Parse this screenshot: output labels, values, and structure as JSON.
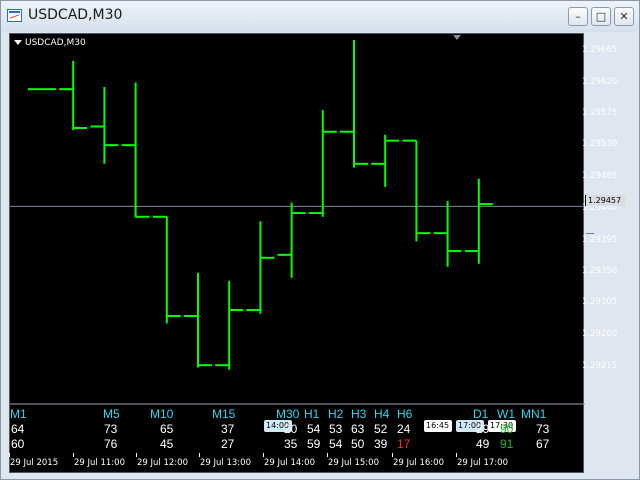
{
  "window": {
    "title": "USDCAD,M30",
    "buttons": {
      "minimize": "–",
      "maximize": "□",
      "close": "✕"
    },
    "icons": {
      "app": "chart-window-icon"
    }
  },
  "chart": {
    "symbol": "USDCAD,M30",
    "current_price": "1.29457",
    "colors": {
      "bars": "#00ff00",
      "background": "#000000",
      "bid_line": "#7b8ba0",
      "text": "#ffffff",
      "tf_label": "#34d6ea",
      "down": "#ff2a2a",
      "up": "#1fbf1f"
    },
    "price_ticks": [
      "1.29665",
      "1.29620",
      "1.29575",
      "1.29530",
      "1.29485",
      "1.29440",
      "1.29395",
      "1.29350",
      "1.29305",
      "1.29260",
      "1.29215"
    ],
    "time_ticks": [
      "29 Jul 2015",
      "29 Jul 11:00",
      "29 Jul 12:00",
      "29 Jul 13:00",
      "29 Jul 14:00",
      "29 Jul 15:00",
      "29 Jul 16:00",
      "29 Jul 17:00"
    ],
    "vline_tags": [
      "14:00",
      "16:45",
      "17:00",
      "17:30"
    ]
  },
  "chart_data": {
    "type": "ohlc",
    "bar_color": "#00ff00",
    "ylim": [
      1.29192,
      1.29688
    ],
    "bid": 1.29457,
    "bars": [
      {
        "o": 1.29614,
        "h": 1.29614,
        "l": 1.29614,
        "c": 1.29614
      },
      {
        "o": 1.29614,
        "h": 1.29652,
        "l": 1.29559,
        "c": 1.29562
      },
      {
        "o": 1.29564,
        "h": 1.29617,
        "l": 1.29514,
        "c": 1.29539
      },
      {
        "o": 1.29539,
        "h": 1.29623,
        "l": 1.29442,
        "c": 1.29443
      },
      {
        "o": 1.29443,
        "h": 1.29443,
        "l": 1.293,
        "c": 1.2931
      },
      {
        "o": 1.2931,
        "h": 1.29368,
        "l": 1.29241,
        "c": 1.29244
      },
      {
        "o": 1.29244,
        "h": 1.29357,
        "l": 1.29238,
        "c": 1.29318
      },
      {
        "o": 1.29318,
        "h": 1.29437,
        "l": 1.29313,
        "c": 1.29388
      },
      {
        "o": 1.29392,
        "h": 1.29462,
        "l": 1.29361,
        "c": 1.29448
      },
      {
        "o": 1.29448,
        "h": 1.29586,
        "l": 1.29443,
        "c": 1.29557
      },
      {
        "o": 1.29557,
        "h": 1.2968,
        "l": 1.29509,
        "c": 1.29514
      },
      {
        "o": 1.29514,
        "h": 1.29553,
        "l": 1.29483,
        "c": 1.29545
      },
      {
        "o": 1.29545,
        "h": 1.29545,
        "l": 1.2941,
        "c": 1.29421
      },
      {
        "o": 1.29421,
        "h": 1.29464,
        "l": 1.29376,
        "c": 1.29397
      },
      {
        "o": 1.29397,
        "h": 1.29494,
        "l": 1.2938,
        "c": 1.2946
      }
    ]
  },
  "timeframes": {
    "labels": [
      "M1",
      "M5",
      "M10",
      "M15",
      "M30",
      "H1",
      "H2",
      "H3",
      "H4",
      "H6",
      "D1",
      "W1",
      "MN1"
    ],
    "row1": [
      "64",
      "73",
      "65",
      "37",
      "20",
      "54",
      "53",
      "63",
      "52",
      "24",
      "29",
      "90",
      "73"
    ],
    "row2": [
      "60",
      "76",
      "45",
      "27",
      "35",
      "59",
      "54",
      "50",
      "39",
      "17",
      "49",
      "91",
      "67"
    ],
    "row1_colors": [
      "#ffffff",
      "#ffffff",
      "#ffffff",
      "#ffffff",
      "#ffffff",
      "#ffffff",
      "#ffffff",
      "#ffffff",
      "#ffffff",
      "#ffffff",
      "#ffffff",
      "#1fbf1f",
      "#ffffff"
    ],
    "row2_colors": [
      "#ffffff",
      "#ffffff",
      "#ffffff",
      "#ffffff",
      "#ffffff",
      "#ffffff",
      "#ffffff",
      "#ffffff",
      "#ffffff",
      "#ff2a2a",
      "#ffffff",
      "#1fbf1f",
      "#ffffff"
    ]
  }
}
